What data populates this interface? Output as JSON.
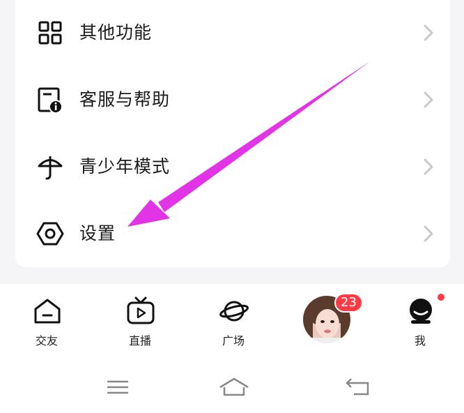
{
  "menu": {
    "items": [
      {
        "label": "其他功能",
        "icon": "grid-icon"
      },
      {
        "label": "客服与帮助",
        "icon": "help-doc-icon"
      },
      {
        "label": "青少年模式",
        "icon": "umbrella-icon"
      },
      {
        "label": "设置",
        "icon": "settings-hex-icon"
      }
    ]
  },
  "tabbar": {
    "tabs": [
      {
        "label": "交友",
        "icon": "home-house-icon"
      },
      {
        "label": "直播",
        "icon": "tv-play-icon"
      },
      {
        "label": "广场",
        "icon": "planet-icon"
      },
      {
        "label": "",
        "icon": "avatar-icon"
      },
      {
        "label": "我",
        "icon": "profile-face-icon"
      }
    ],
    "message_badge": "23"
  },
  "colors": {
    "accent_arrow": "#e233e6",
    "badge": "#ff3b46"
  }
}
